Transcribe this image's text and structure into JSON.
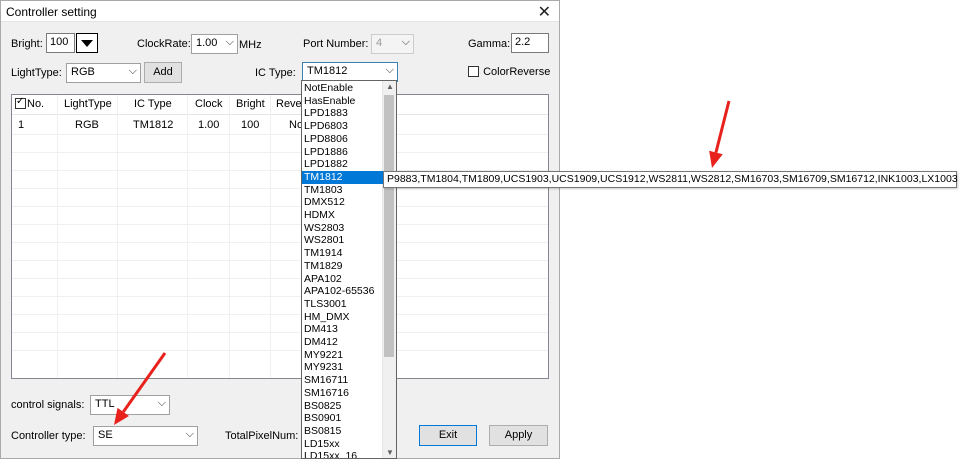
{
  "window": {
    "title": "Controller setting",
    "close_symbol": "✕"
  },
  "bright": {
    "label": "Bright:",
    "value": "100"
  },
  "clockrate": {
    "label": "ClockRate:",
    "value": "1.00",
    "unit": "MHz"
  },
  "port_number": {
    "label": "Port Number:",
    "value": "4"
  },
  "gamma": {
    "label": "Gamma:",
    "value": "2.2"
  },
  "light_type": {
    "label": "LightType:",
    "value": "RGB",
    "add_label": "Add"
  },
  "ic_type": {
    "label": "IC Type:",
    "value": "TM1812"
  },
  "color_reverse": {
    "label": "ColorReverse",
    "checked": false
  },
  "table": {
    "headers": [
      "No.",
      "LightType",
      "IC Type",
      "Clock",
      "Bright",
      "Rever"
    ],
    "rows": [
      [
        "1",
        "RGB",
        "TM1812",
        "1.00",
        "100",
        "No"
      ]
    ]
  },
  "dropdown": {
    "items": [
      "NotEnable",
      "HasEnable",
      "LPD1883",
      "LPD6803",
      "LPD8806",
      "LPD1886",
      "LPD1882",
      "TM1812",
      "TM1803",
      "DMX512",
      "HDMX",
      "WS2803",
      "WS2801",
      "TM1914",
      "TM1829",
      "APA102",
      "APA102-65536",
      "TLS3001",
      "HM_DMX",
      "DM413",
      "DM412",
      "MY9221",
      "MY9231",
      "SM16711",
      "SM16716",
      "BS0825",
      "BS0901",
      "BS0815",
      "LD15xx",
      "LD15xx_16"
    ],
    "selected_index": 7
  },
  "tooltip": "P9883,TM1804,TM1809,UCS1903,UCS1909,UCS1912,WS2811,WS2812,SM16703,SM16709,SM16712,INK1003,LX1003",
  "control_signals": {
    "label": "control signals:",
    "value": "TTL"
  },
  "controller_type": {
    "label": "Controller type:",
    "value": "SE"
  },
  "total_pixel": {
    "label": "TotalPixelNum:"
  },
  "buttons": {
    "exit": "Exit",
    "apply": "Apply"
  },
  "annotation_color": "#e8211c"
}
